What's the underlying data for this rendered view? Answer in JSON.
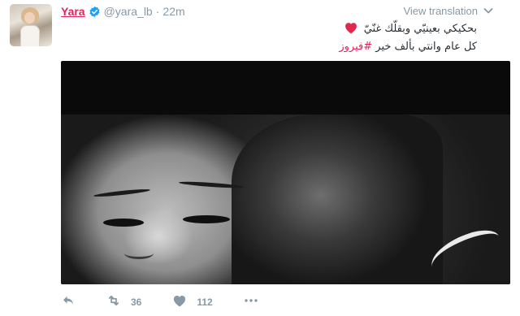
{
  "tweet": {
    "author_name": "Yara",
    "handle": "@yara_lb",
    "separator": "·",
    "time": "22m",
    "view_translation": "View translation",
    "text_line1": "بحكيكي بعينيّي وبقلّك غنّيّ",
    "text_line2": "كل عام وانتي بألف خير",
    "hashtag": "#فيروز",
    "retweet_count": "36",
    "like_count": "112"
  },
  "icons": {
    "verified": "verified-badge-icon",
    "caret": "chevron-down-icon",
    "heart_emoji": "red-heart-icon",
    "reply": "reply-icon",
    "retweet": "retweet-icon",
    "like": "heart-icon",
    "more": "more-dots-icon"
  },
  "colors": {
    "accent": "#e0245e",
    "muted": "#8899a6",
    "verified": "#1da1f2",
    "heart": "#e2264d"
  }
}
